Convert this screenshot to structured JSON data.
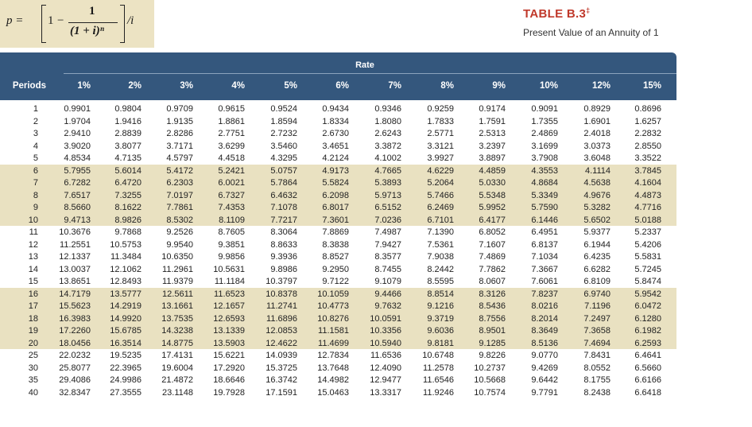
{
  "formula": {
    "lhs": "p =",
    "one": "1",
    "minus": "−",
    "numerator": "1",
    "denominator": "(1 + i)ⁿ",
    "rhs": "/i"
  },
  "title": "TABLE B.3",
  "title_mark": "‡",
  "subtitle": "Present Value of an Annuity of 1",
  "rate_label": "Rate",
  "periods_label": "Periods",
  "rates": [
    "1%",
    "2%",
    "3%",
    "4%",
    "5%",
    "6%",
    "7%",
    "8%",
    "9%",
    "10%",
    "12%",
    "15%"
  ],
  "rows": [
    {
      "period": "1",
      "values": [
        "0.9901",
        "0.9804",
        "0.9709",
        "0.9615",
        "0.9524",
        "0.9434",
        "0.9346",
        "0.9259",
        "0.9174",
        "0.9091",
        "0.8929",
        "0.8696"
      ]
    },
    {
      "period": "2",
      "values": [
        "1.9704",
        "1.9416",
        "1.9135",
        "1.8861",
        "1.8594",
        "1.8334",
        "1.8080",
        "1.7833",
        "1.7591",
        "1.7355",
        "1.6901",
        "1.6257"
      ]
    },
    {
      "period": "3",
      "values": [
        "2.9410",
        "2.8839",
        "2.8286",
        "2.7751",
        "2.7232",
        "2.6730",
        "2.6243",
        "2.5771",
        "2.5313",
        "2.4869",
        "2.4018",
        "2.2832"
      ]
    },
    {
      "period": "4",
      "values": [
        "3.9020",
        "3.8077",
        "3.7171",
        "3.6299",
        "3.5460",
        "3.4651",
        "3.3872",
        "3.3121",
        "3.2397",
        "3.1699",
        "3.0373",
        "2.8550"
      ]
    },
    {
      "period": "5",
      "values": [
        "4.8534",
        "4.7135",
        "4.5797",
        "4.4518",
        "4.3295",
        "4.2124",
        "4.1002",
        "3.9927",
        "3.8897",
        "3.7908",
        "3.6048",
        "3.3522"
      ]
    },
    {
      "period": "6",
      "values": [
        "5.7955",
        "5.6014",
        "5.4172",
        "5.2421",
        "5.0757",
        "4.9173",
        "4.7665",
        "4.6229",
        "4.4859",
        "4.3553",
        "4.1114",
        "3.7845"
      ]
    },
    {
      "period": "7",
      "values": [
        "6.7282",
        "6.4720",
        "6.2303",
        "6.0021",
        "5.7864",
        "5.5824",
        "5.3893",
        "5.2064",
        "5.0330",
        "4.8684",
        "4.5638",
        "4.1604"
      ]
    },
    {
      "period": "8",
      "values": [
        "7.6517",
        "7.3255",
        "7.0197",
        "6.7327",
        "6.4632",
        "6.2098",
        "5.9713",
        "5.7466",
        "5.5348",
        "5.3349",
        "4.9676",
        "4.4873"
      ]
    },
    {
      "period": "9",
      "values": [
        "8.5660",
        "8.1622",
        "7.7861",
        "7.4353",
        "7.1078",
        "6.8017",
        "6.5152",
        "6.2469",
        "5.9952",
        "5.7590",
        "5.3282",
        "4.7716"
      ]
    },
    {
      "period": "10",
      "values": [
        "9.4713",
        "8.9826",
        "8.5302",
        "8.1109",
        "7.7217",
        "7.3601",
        "7.0236",
        "6.7101",
        "6.4177",
        "6.1446",
        "5.6502",
        "5.0188"
      ]
    },
    {
      "period": "11",
      "values": [
        "10.3676",
        "9.7868",
        "9.2526",
        "8.7605",
        "8.3064",
        "7.8869",
        "7.4987",
        "7.1390",
        "6.8052",
        "6.4951",
        "5.9377",
        "5.2337"
      ]
    },
    {
      "period": "12",
      "values": [
        "11.2551",
        "10.5753",
        "9.9540",
        "9.3851",
        "8.8633",
        "8.3838",
        "7.9427",
        "7.5361",
        "7.1607",
        "6.8137",
        "6.1944",
        "5.4206"
      ]
    },
    {
      "period": "13",
      "values": [
        "12.1337",
        "11.3484",
        "10.6350",
        "9.9856",
        "9.3936",
        "8.8527",
        "8.3577",
        "7.9038",
        "7.4869",
        "7.1034",
        "6.4235",
        "5.5831"
      ]
    },
    {
      "period": "14",
      "values": [
        "13.0037",
        "12.1062",
        "11.2961",
        "10.5631",
        "9.8986",
        "9.2950",
        "8.7455",
        "8.2442",
        "7.7862",
        "7.3667",
        "6.6282",
        "5.7245"
      ]
    },
    {
      "period": "15",
      "values": [
        "13.8651",
        "12.8493",
        "11.9379",
        "11.1184",
        "10.3797",
        "9.7122",
        "9.1079",
        "8.5595",
        "8.0607",
        "7.6061",
        "6.8109",
        "5.8474"
      ]
    },
    {
      "period": "16",
      "values": [
        "14.7179",
        "13.5777",
        "12.5611",
        "11.6523",
        "10.8378",
        "10.1059",
        "9.4466",
        "8.8514",
        "8.3126",
        "7.8237",
        "6.9740",
        "5.9542"
      ]
    },
    {
      "period": "17",
      "values": [
        "15.5623",
        "14.2919",
        "13.1661",
        "12.1657",
        "11.2741",
        "10.4773",
        "9.7632",
        "9.1216",
        "8.5436",
        "8.0216",
        "7.1196",
        "6.0472"
      ]
    },
    {
      "period": "18",
      "values": [
        "16.3983",
        "14.9920",
        "13.7535",
        "12.6593",
        "11.6896",
        "10.8276",
        "10.0591",
        "9.3719",
        "8.7556",
        "8.2014",
        "7.2497",
        "6.1280"
      ]
    },
    {
      "period": "19",
      "values": [
        "17.2260",
        "15.6785",
        "14.3238",
        "13.1339",
        "12.0853",
        "11.1581",
        "10.3356",
        "9.6036",
        "8.9501",
        "8.3649",
        "7.3658",
        "6.1982"
      ]
    },
    {
      "period": "20",
      "values": [
        "18.0456",
        "16.3514",
        "14.8775",
        "13.5903",
        "12.4622",
        "11.4699",
        "10.5940",
        "9.8181",
        "9.1285",
        "8.5136",
        "7.4694",
        "6.2593"
      ]
    },
    {
      "period": "25",
      "values": [
        "22.0232",
        "19.5235",
        "17.4131",
        "15.6221",
        "14.0939",
        "12.7834",
        "11.6536",
        "10.6748",
        "9.8226",
        "9.0770",
        "7.8431",
        "6.4641"
      ]
    },
    {
      "period": "30",
      "values": [
        "25.8077",
        "22.3965",
        "19.6004",
        "17.2920",
        "15.3725",
        "13.7648",
        "12.4090",
        "11.2578",
        "10.2737",
        "9.4269",
        "8.0552",
        "6.5660"
      ]
    },
    {
      "period": "35",
      "values": [
        "29.4086",
        "24.9986",
        "21.4872",
        "18.6646",
        "16.3742",
        "14.4982",
        "12.9477",
        "11.6546",
        "10.5668",
        "9.6442",
        "8.1755",
        "6.6166"
      ]
    },
    {
      "period": "40",
      "values": [
        "32.8347",
        "27.3555",
        "23.1148",
        "19.7928",
        "17.1591",
        "15.0463",
        "13.3317",
        "11.9246",
        "10.7574",
        "9.7791",
        "8.2438",
        "6.6418"
      ]
    }
  ]
}
